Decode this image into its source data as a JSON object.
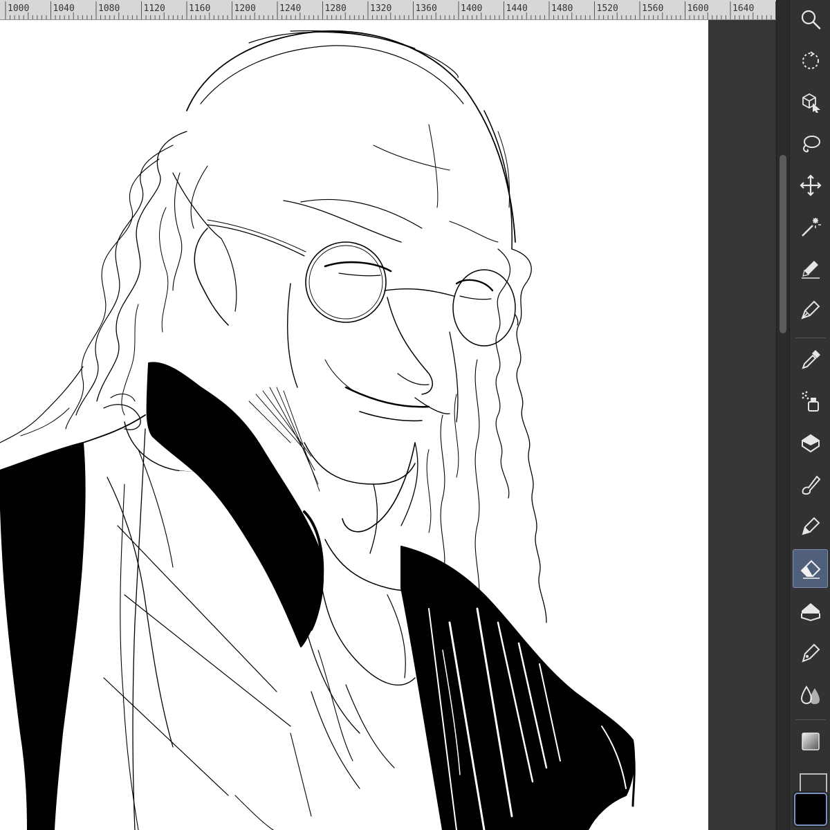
{
  "ruler": {
    "labels": [
      "1000",
      "1040",
      "1080",
      "1120",
      "1160",
      "1200",
      "1240",
      "1280",
      "1320",
      "1360",
      "1400",
      "1440",
      "1480",
      "1520",
      "1560",
      "1600",
      "1640"
    ]
  },
  "canvas": {
    "content": "line-art sketch of an elderly man with round glasses and long wavy hair",
    "paper_color": "#ffffff"
  },
  "toolbar": {
    "tools": [
      {
        "name": "zoom",
        "icon": "magnifier-icon",
        "active": false
      },
      {
        "name": "rotate",
        "icon": "rotate-icon",
        "active": false
      },
      {
        "name": "operation",
        "icon": "object-select-icon",
        "active": false
      },
      {
        "name": "lasso",
        "icon": "lasso-icon",
        "active": false
      },
      {
        "name": "move",
        "icon": "move-icon",
        "active": false
      },
      {
        "name": "auto-select",
        "icon": "magic-wand-icon",
        "active": false
      },
      {
        "name": "pencil",
        "icon": "pencil-icon",
        "active": false
      },
      {
        "name": "pen",
        "icon": "pen-icon",
        "active": false
      },
      {
        "name": "eyedropper",
        "icon": "eyedropper-icon",
        "active": false
      },
      {
        "name": "airbrush",
        "icon": "airbrush-icon",
        "active": false
      },
      {
        "name": "decoration",
        "icon": "decoration-icon",
        "active": false
      },
      {
        "name": "brush",
        "icon": "brush-icon",
        "active": false
      },
      {
        "name": "marker",
        "icon": "marker-icon",
        "active": false
      },
      {
        "name": "eraser",
        "icon": "eraser-icon",
        "active": true
      },
      {
        "name": "fill",
        "icon": "fill-bucket-icon",
        "active": false
      },
      {
        "name": "vector-pen",
        "icon": "vector-pen-icon",
        "active": false
      },
      {
        "name": "blend",
        "icon": "blend-drops-icon",
        "active": false
      },
      {
        "name": "gradient",
        "icon": "gradient-icon",
        "active": false
      }
    ],
    "main_color": "#000000",
    "accent": "#51607a"
  }
}
